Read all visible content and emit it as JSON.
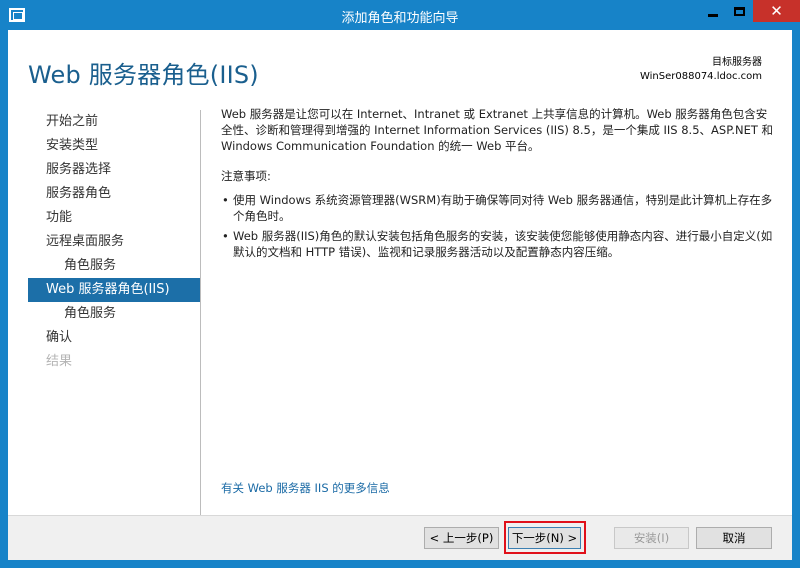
{
  "window": {
    "title": "添加角色和功能向导",
    "close_glyph": "✕"
  },
  "header": {
    "page_title": "Web 服务器角色(IIS)",
    "destination_label": "目标服务器",
    "destination_server": "WinSer088074.ldoc.com"
  },
  "nav": {
    "items": [
      {
        "label": "开始之前",
        "state": "normal"
      },
      {
        "label": "安装类型",
        "state": "normal"
      },
      {
        "label": "服务器选择",
        "state": "normal"
      },
      {
        "label": "服务器角色",
        "state": "normal"
      },
      {
        "label": "功能",
        "state": "normal"
      },
      {
        "label": "远程桌面服务",
        "state": "normal"
      },
      {
        "label": "角色服务",
        "state": "sub"
      },
      {
        "label": "Web 服务器角色(IIS)",
        "state": "active"
      },
      {
        "label": "角色服务",
        "state": "sub"
      },
      {
        "label": "确认",
        "state": "normal"
      },
      {
        "label": "结果",
        "state": "disabled"
      }
    ]
  },
  "main": {
    "intro": "Web 服务器是让您可以在 Internet、Intranet 或 Extranet 上共享信息的计算机。Web 服务器角色包含安全性、诊断和管理得到增强的 Internet Information Services (IIS) 8.5，是一个集成 IIS 8.5、ASP.NET 和 Windows Communication Foundation 的统一 Web 平台。",
    "notes_title": "注意事项:",
    "notes": [
      "使用 Windows 系统资源管理器(WSRM)有助于确保等同对待 Web 服务器通信，特别是此计算机上存在多个角色时。",
      "Web 服务器(IIS)角色的默认安装包括角色服务的安装，该安装使您能够使用静态内容、进行最小自定义(如默认的文档和 HTTP 错误)、监视和记录服务器活动以及配置静态内容压缩。"
    ],
    "more_info_link": "有关 Web 服务器 IIS 的更多信息"
  },
  "buttons": {
    "prev": "< 上一步(P)",
    "next": "下一步(N) >",
    "install": "安装(I)",
    "cancel": "取消"
  },
  "colors": {
    "titlebar": "#1783c8",
    "close": "#c7312a",
    "accent_title": "#1a5f8e",
    "nav_active": "#1c6fa8",
    "highlight": "#e0101a"
  }
}
